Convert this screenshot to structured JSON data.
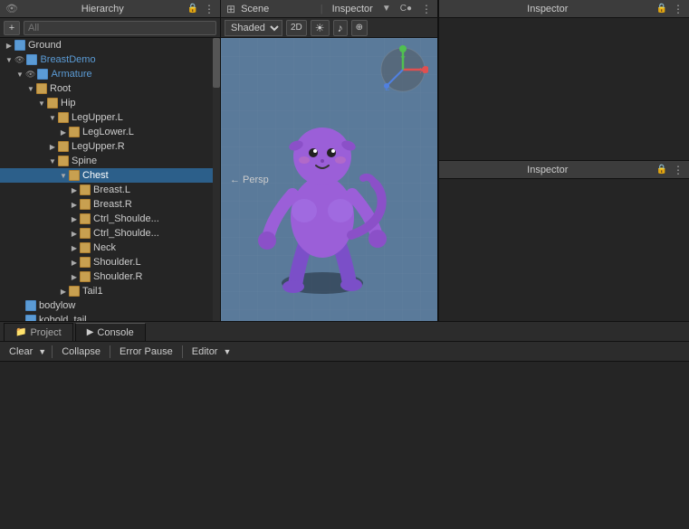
{
  "hierarchy": {
    "title": "Hierarchy",
    "search_placeholder": "All",
    "items": [
      {
        "id": "ground",
        "label": "Ground",
        "indent": 0,
        "type": "gameobj",
        "expanded": false,
        "selected": false
      },
      {
        "id": "breastdemo",
        "label": "BreastDemo",
        "indent": 0,
        "type": "gameobj",
        "expanded": true,
        "selected": false,
        "has_eye": true
      },
      {
        "id": "armature",
        "label": "Armature",
        "indent": 1,
        "type": "gameobj",
        "expanded": true,
        "selected": false
      },
      {
        "id": "root",
        "label": "Root",
        "indent": 2,
        "type": "bone",
        "expanded": true,
        "selected": false
      },
      {
        "id": "hip",
        "label": "Hip",
        "indent": 3,
        "type": "bone",
        "expanded": true,
        "selected": false
      },
      {
        "id": "legupper_l",
        "label": "LegUpper.L",
        "indent": 4,
        "type": "bone",
        "expanded": true,
        "selected": false
      },
      {
        "id": "leglower_l",
        "label": "LegLower.L",
        "indent": 5,
        "type": "bone",
        "expanded": false,
        "selected": false
      },
      {
        "id": "legupper_r",
        "label": "LegUpper.R",
        "indent": 4,
        "type": "bone",
        "expanded": true,
        "selected": false
      },
      {
        "id": "spine",
        "label": "Spine",
        "indent": 4,
        "type": "bone",
        "expanded": true,
        "selected": false
      },
      {
        "id": "chest",
        "label": "Chest",
        "indent": 5,
        "type": "bone",
        "expanded": true,
        "selected": true
      },
      {
        "id": "breast_l",
        "label": "Breast.L",
        "indent": 6,
        "type": "bone",
        "expanded": false,
        "selected": false
      },
      {
        "id": "breast_r",
        "label": "Breast.R",
        "indent": 6,
        "type": "bone",
        "expanded": false,
        "selected": false
      },
      {
        "id": "ctrl_shoulder_l",
        "label": "Ctrl_Shoulde...",
        "indent": 6,
        "type": "bone",
        "expanded": false,
        "selected": false
      },
      {
        "id": "ctrl_shoulder_r",
        "label": "Ctrl_Shoulde...",
        "indent": 6,
        "type": "bone",
        "expanded": false,
        "selected": false
      },
      {
        "id": "neck",
        "label": "Neck",
        "indent": 6,
        "type": "bone",
        "expanded": false,
        "selected": false
      },
      {
        "id": "shoulder_l",
        "label": "Shoulder.L",
        "indent": 6,
        "type": "bone",
        "expanded": false,
        "selected": false
      },
      {
        "id": "shoulder_r",
        "label": "Shoulder.R",
        "indent": 6,
        "type": "bone",
        "expanded": false,
        "selected": false
      },
      {
        "id": "tail1",
        "label": "Tail1",
        "indent": 5,
        "type": "bone",
        "expanded": false,
        "selected": false
      },
      {
        "id": "bodylow",
        "label": "bodylow",
        "indent": 1,
        "type": "gameobj",
        "expanded": false,
        "selected": false
      },
      {
        "id": "kobold_tail",
        "label": "kobold_tail",
        "indent": 1,
        "type": "gameobj",
        "expanded": false,
        "selected": false
      }
    ]
  },
  "scene": {
    "title": "Scene",
    "shading_mode": "Shaded",
    "dimension": "2D",
    "persp_label": "← Persp"
  },
  "inspectors": [
    {
      "title": "Inspector",
      "id": "inspector1"
    },
    {
      "title": "Inspector",
      "id": "inspector2"
    }
  ],
  "bottom": {
    "tabs": [
      {
        "label": "Project",
        "icon": "folder"
      },
      {
        "label": "Console",
        "icon": "console",
        "active": true
      }
    ],
    "toolbar": {
      "clear_label": "Clear",
      "collapse_label": "Collapse",
      "error_pause_label": "Error Pause",
      "editor_label": "Editor"
    }
  },
  "icons": {
    "lock": "🔒",
    "more": "⋮",
    "add": "+",
    "folder": "📁",
    "cube": "■",
    "bone": "⬡",
    "eye": "👁",
    "search": "🔍",
    "scene_grid": "⊞",
    "sun": "☀",
    "speaker": "♪",
    "layers": "⊕"
  }
}
